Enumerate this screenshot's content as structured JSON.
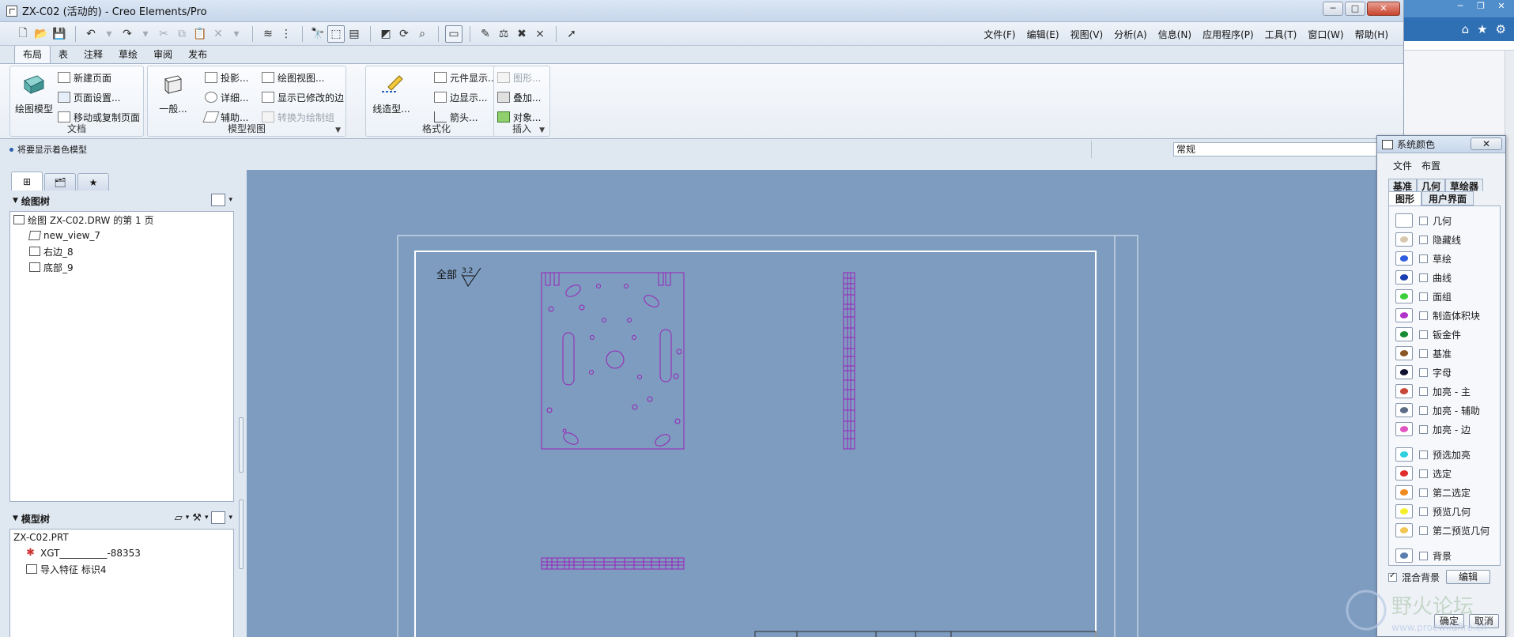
{
  "window": {
    "title": "ZX-C02 (活动的) - Creo Elements/Pro",
    "min": "─",
    "max": "□",
    "close": "✕"
  },
  "menu": [
    "文件(F)",
    "编辑(E)",
    "视图(V)",
    "分析(A)",
    "信息(N)",
    "应用程序(P)",
    "工具(T)",
    "窗口(W)",
    "帮助(H)"
  ],
  "ribbon_tabs": [
    "布局",
    "表",
    "注释",
    "草绘",
    "审阅",
    "发布"
  ],
  "ribbon": {
    "doc": {
      "label": "文档",
      "big": "绘图模型",
      "items": [
        "新建页面",
        "页面设置...",
        "移动或复制页面"
      ]
    },
    "model_view": {
      "label": "模型视图",
      "big": "一般...",
      "col1": [
        "投影...",
        "详细...",
        "辅助..."
      ],
      "col2": [
        "绘图视图...",
        "显示已修改的边",
        "转换为绘制组"
      ]
    },
    "format": {
      "label": "格式化",
      "big": "线造型...",
      "items": [
        "元件显示...",
        "边显示...",
        "箭头..."
      ]
    },
    "insert": {
      "label": "插入",
      "items": [
        "图形...",
        "叠加...",
        "对象..."
      ]
    }
  },
  "status": {
    "message": "将要显示着色模型",
    "filter": "常规"
  },
  "drawing_tree": {
    "title": "绘图树",
    "items": [
      "绘图 ZX-C02.DRW 的第 1 页",
      "new_view_7",
      "右边_8",
      "底部_9"
    ]
  },
  "model_tree": {
    "title": "模型树",
    "items": [
      "ZX-C02.PRT",
      "XGT__________-88353",
      "导入特征 标识4"
    ]
  },
  "drawing": {
    "roughness_label": "全部",
    "roughness_value": "3.2"
  },
  "dialog": {
    "title": "系统颜色",
    "menu": [
      "文件",
      "布置"
    ],
    "tabs_back": [
      "基准",
      "几何",
      "草绘器"
    ],
    "tabs_front": [
      "图形",
      "用户界面"
    ],
    "colors": [
      {
        "label": "几何",
        "color": "#ffffff"
      },
      {
        "label": "隐藏线",
        "color": "#d8c8b0"
      },
      {
        "label": "草绘",
        "color": "#2f5fe0"
      },
      {
        "label": "曲线",
        "color": "#1a3fb0"
      },
      {
        "label": "面组",
        "color": "#3ccf3c"
      },
      {
        "label": "制造体积块",
        "color": "#b233c8"
      },
      {
        "label": "钣金件",
        "color": "#178a33"
      },
      {
        "label": "基准",
        "color": "#8a5626"
      },
      {
        "label": "字母",
        "color": "#101030"
      },
      {
        "label": "加亮 - 主",
        "color": "#c8453a"
      },
      {
        "label": "加亮 - 辅助",
        "color": "#5b6a86"
      },
      {
        "label": "加亮 - 边",
        "color": "#e055c0"
      },
      {
        "label": "预选加亮",
        "color": "#30d0e0"
      },
      {
        "label": "选定",
        "color": "#e02b2b"
      },
      {
        "label": "第二选定",
        "color": "#f08a1e"
      },
      {
        "label": "预览几何",
        "color": "#f4ef2a"
      },
      {
        "label": "第二预览几何",
        "color": "#f2c655"
      },
      {
        "label": "背景",
        "color": "#5b7fb0"
      }
    ],
    "blend_bg": "混合背景",
    "edit": "编辑",
    "ok": "确定",
    "cancel": "取消"
  },
  "watermark": {
    "text": "野火论坛",
    "url": "www.proewildfire.cn"
  }
}
